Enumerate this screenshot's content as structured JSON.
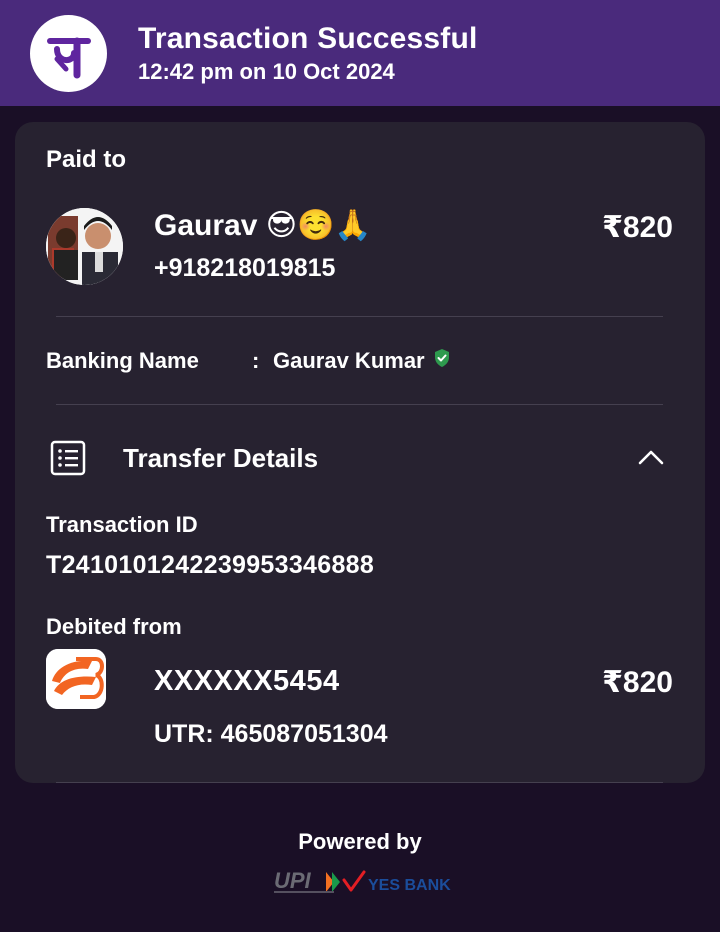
{
  "header": {
    "title": "Transaction Successful",
    "timestamp": "12:42 pm on 10 Oct 2024",
    "logo_icon": "phonepe-logo-icon",
    "background_color": "#4a2a7c"
  },
  "paid_to": {
    "label": "Paid to",
    "name": "Gaurav 😎☺️🙏",
    "phone": "+918218019815",
    "amount": "₹820",
    "avatar_icon": "avatar-photo"
  },
  "banking": {
    "label": "Banking Name",
    "separator": ":",
    "value": "Gaurav Kumar",
    "verified_icon": "verified-shield-icon",
    "verified_color": "#2e9a4e"
  },
  "transfer_details": {
    "title": "Transfer Details",
    "icon": "list-document-icon",
    "toggle_icon": "chevron-up-icon",
    "transaction_id_label": "Transaction ID",
    "transaction_id": "T2410101242239953346888",
    "debited_label": "Debited from",
    "account": "XXXXXX5454",
    "amount": "₹820",
    "utr": "UTR: 465087051304",
    "bank_icon": "bank-of-baroda-logo"
  },
  "footer": {
    "powered_by": "Powered by",
    "logos": [
      "upi-logo",
      "yes-bank-logo"
    ],
    "upi_text": "UPI",
    "yes_bank_text": "YES BANK"
  }
}
